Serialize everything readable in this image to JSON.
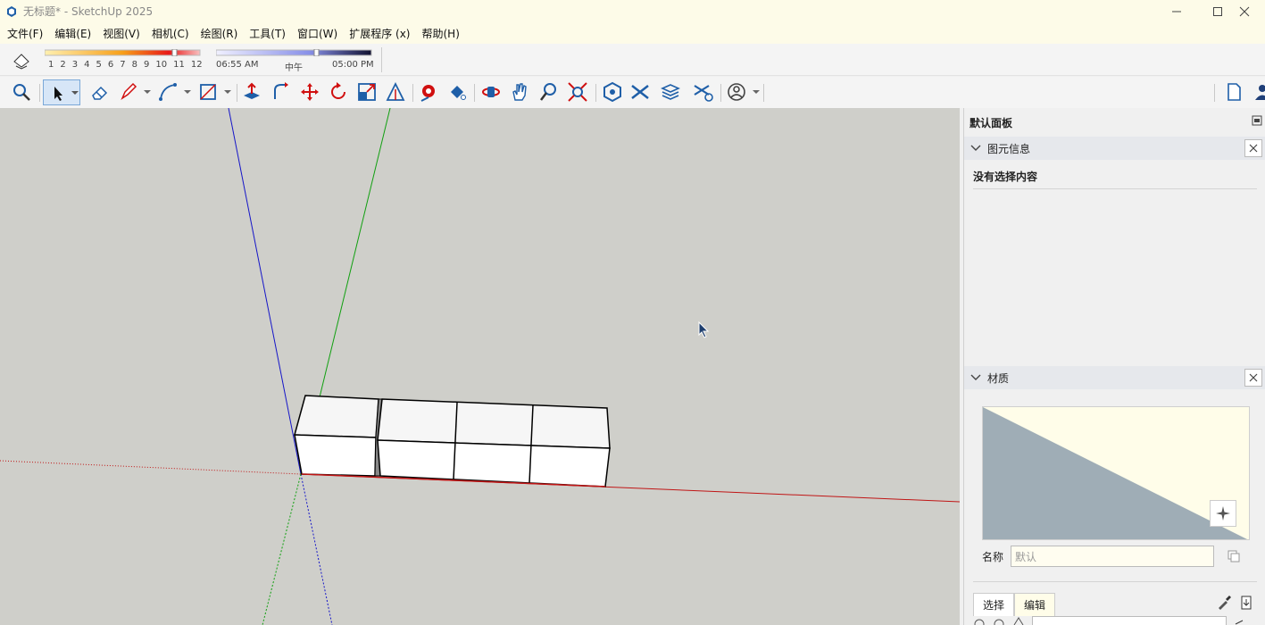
{
  "window": {
    "title": "无标题* - SketchUp 2025"
  },
  "menu": [
    "文件(F)",
    "编辑(E)",
    "视图(V)",
    "相机(C)",
    "绘图(R)",
    "工具(T)",
    "窗口(W)",
    "扩展程序 (x)",
    "帮助(H)"
  ],
  "shadow": {
    "months": [
      "1",
      "2",
      "3",
      "4",
      "5",
      "6",
      "7",
      "8",
      "9",
      "10",
      "11",
      "12"
    ],
    "time_start": "06:55 AM",
    "time_mid": "中午",
    "time_end": "05:00 PM"
  },
  "panel": {
    "title": "默认面板",
    "entity_section": "图元信息",
    "no_selection": "没有选择内容",
    "material_section": "材质",
    "name_label": "名称",
    "name_value": "默认",
    "tab_select": "选择",
    "tab_edit": "编辑"
  },
  "colors": {
    "accent": "#1f6fd1",
    "viewport_bg": "#cfcfca",
    "panel_header": "#e6e8ec"
  }
}
